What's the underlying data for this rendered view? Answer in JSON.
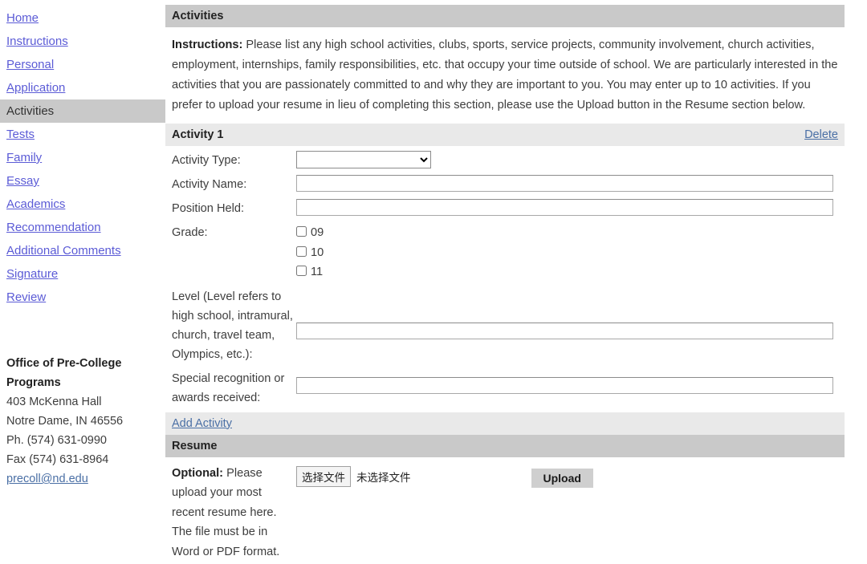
{
  "sidebar": {
    "items": [
      {
        "label": "Home",
        "active": false
      },
      {
        "label": "Instructions",
        "active": false
      },
      {
        "label": "Personal",
        "active": false
      },
      {
        "label": "Application",
        "active": false
      },
      {
        "label": "Activities",
        "active": true
      },
      {
        "label": "Tests",
        "active": false
      },
      {
        "label": "Family",
        "active": false
      },
      {
        "label": "Essay",
        "active": false
      },
      {
        "label": "Academics",
        "active": false
      },
      {
        "label": "Recommendation",
        "active": false
      },
      {
        "label": "Additional Comments",
        "active": false
      },
      {
        "label": "Signature",
        "active": false
      },
      {
        "label": "Review",
        "active": false
      }
    ],
    "address": {
      "office_line1": "Office of Pre-College",
      "office_line2": "Programs",
      "street": "403 McKenna Hall",
      "city_state_zip": "Notre Dame, IN 46556",
      "phone": "Ph. (574) 631-0990",
      "fax": "Fax (574) 631-8964",
      "email": "precoll@nd.edu"
    }
  },
  "main": {
    "section_title": "Activities",
    "instructions_label": "Instructions:",
    "instructions_body": " Please list any high school activities, clubs, sports, service projects, community involvement, church activities, employment, internships, family responsibilities, etc. that occupy your time outside of school. We are particularly interested in the activities that you are passionately committed to and why they are important to you. You may enter up to 10 activities. If you prefer to upload your resume in lieu of completing this section, please use the Upload button in the Resume section below.",
    "activity": {
      "header": "Activity 1",
      "delete_label": "Delete",
      "fields": {
        "activity_type_label": "Activity Type:",
        "activity_type_value": "",
        "activity_name_label": "Activity Name:",
        "activity_name_value": "",
        "position_held_label": "Position Held:",
        "position_held_value": "",
        "grade_label": "Grade:",
        "grades": [
          {
            "label": "09",
            "checked": false
          },
          {
            "label": "10",
            "checked": false
          },
          {
            "label": "11",
            "checked": false
          }
        ],
        "level_label": "Level (Level refers to high school, intramural, church, travel team, Olympics, etc.):",
        "level_value": "",
        "awards_label": "Special recognition or awards received:",
        "awards_value": ""
      }
    },
    "add_activity_label": "Add Activity",
    "resume": {
      "header": "Resume",
      "optional_label": "Optional:",
      "optional_body": " Please upload your most recent resume here. The file must be in Word or PDF format.",
      "choose_file_label": "选择文件",
      "no_file_label": "未选择文件",
      "upload_button_label": "Upload"
    }
  }
}
